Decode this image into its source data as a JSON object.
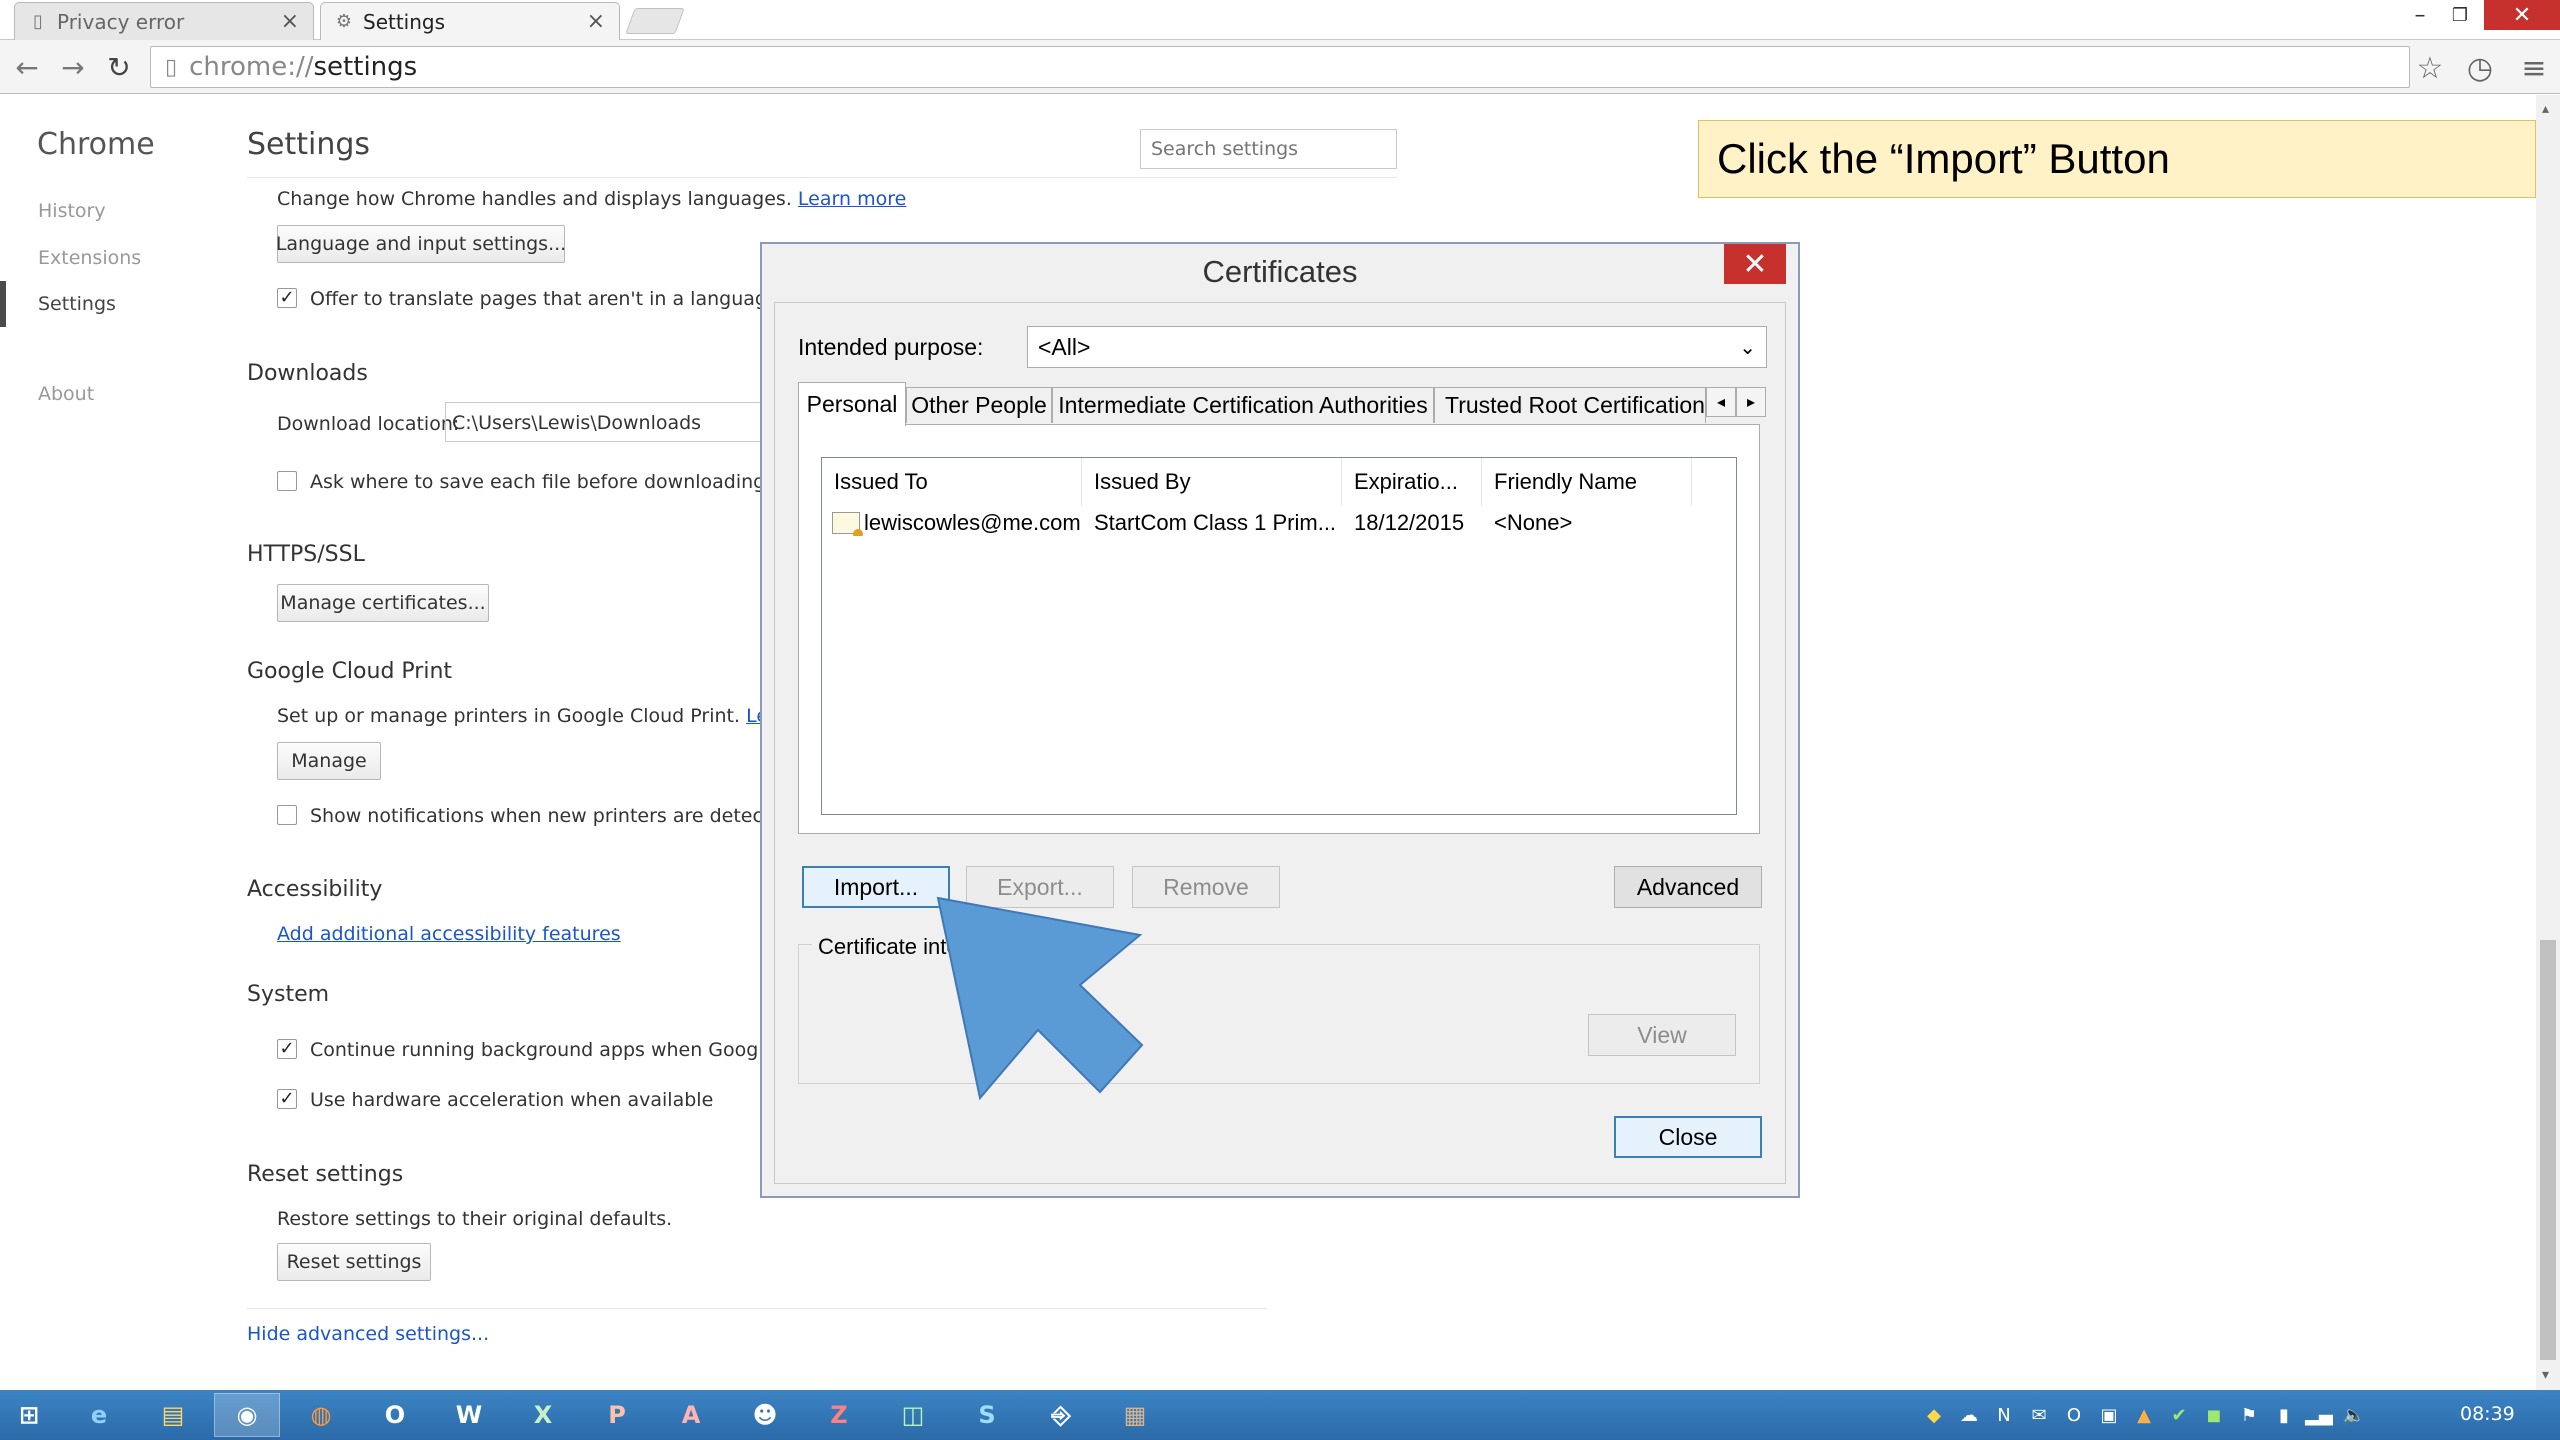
{
  "browser": {
    "tabs": [
      {
        "title": "Privacy error",
        "active": false
      },
      {
        "title": "Settings",
        "active": true
      }
    ],
    "url_scheme": "chrome://",
    "url_host": "settings"
  },
  "settings": {
    "nav_title": "Chrome",
    "nav_items": [
      "History",
      "Extensions",
      "Settings",
      "About"
    ],
    "page_title": "Settings",
    "search_placeholder": "Search settings",
    "languages": {
      "desc": "Change how Chrome handles and displays languages.",
      "learn_more": "Learn more",
      "button": "Language and input settings...",
      "translate_label": "Offer to translate pages that aren't in a language you"
    },
    "downloads": {
      "heading": "Downloads",
      "location_label": "Download location:",
      "location_value": "C:\\Users\\Lewis\\Downloads",
      "ask_label": "Ask where to save each file before downloading"
    },
    "https": {
      "heading": "HTTPS/SSL",
      "button": "Manage certificates..."
    },
    "cloud_print": {
      "heading": "Google Cloud Print",
      "desc": "Set up or manage printers in Google Cloud Print.",
      "learn_more": "Learn m",
      "button": "Manage",
      "notify_label": "Show notifications when new printers are detected or"
    },
    "accessibility": {
      "heading": "Accessibility",
      "link": "Add additional accessibility features"
    },
    "system": {
      "heading": "System",
      "background_label": "Continue running background apps when Google Ch",
      "hw_label": "Use hardware acceleration when available"
    },
    "reset": {
      "heading": "Reset settings",
      "desc": "Restore settings to their original defaults.",
      "button": "Reset settings"
    },
    "hide_advanced": "Hide advanced settings..."
  },
  "callout": {
    "text": "Click the “Import” Button"
  },
  "dialog": {
    "title": "Certificates",
    "purpose_label": "Intended purpose:",
    "purpose_value": "<All>",
    "tabs": [
      "Personal",
      "Other People",
      "Intermediate Certification Authorities",
      "Trusted Root Certification"
    ],
    "columns": [
      "Issued To",
      "Issued By",
      "Expiratio...",
      "Friendly Name"
    ],
    "rows": [
      {
        "issued_to": "lewiscowles@me.com",
        "issued_by": "StartCom Class 1 Prim...",
        "expiration": "18/12/2015",
        "friendly": "<None>"
      }
    ],
    "buttons": {
      "import": "Import...",
      "export": "Export...",
      "remove": "Remove",
      "advanced": "Advanced",
      "view": "View",
      "close": "Close"
    },
    "intended_label": "Certificate inte"
  },
  "taskbar": {
    "clock": "08:39"
  },
  "colors": {
    "accent_arrow": "#5b9bd5",
    "close_red": "#c7312d",
    "link_blue": "#1a55c9",
    "callout_bg": "#fff2c6"
  }
}
